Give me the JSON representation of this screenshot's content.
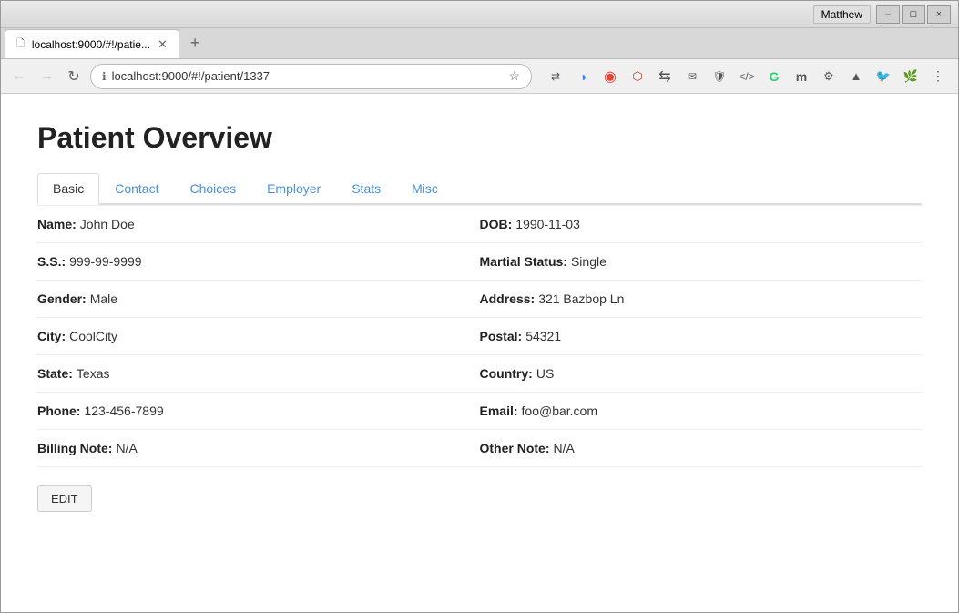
{
  "browser": {
    "tab_label": "localhost:9000/#!/patie...",
    "url": "localhost:9000/#!/patient/1337",
    "user": "Matthew"
  },
  "page": {
    "title": "Patient Overview"
  },
  "tabs": [
    {
      "id": "basic",
      "label": "Basic",
      "active": true
    },
    {
      "id": "contact",
      "label": "Contact",
      "active": false
    },
    {
      "id": "choices",
      "label": "Choices",
      "active": false
    },
    {
      "id": "employer",
      "label": "Employer",
      "active": false
    },
    {
      "id": "stats",
      "label": "Stats",
      "active": false
    },
    {
      "id": "misc",
      "label": "Misc",
      "active": false
    }
  ],
  "fields": {
    "left": [
      {
        "label": "Name:",
        "value": "John Doe"
      },
      {
        "label": "S.S.:",
        "value": "999-99-9999"
      },
      {
        "label": "Gender:",
        "value": "Male"
      },
      {
        "label": "City:",
        "value": "CoolCity"
      },
      {
        "label": "State:",
        "value": "Texas"
      },
      {
        "label": "Phone:",
        "value": "123-456-7899"
      },
      {
        "label": "Billing Note:",
        "value": "N/A"
      }
    ],
    "right": [
      {
        "label": "DOB:",
        "value": "1990-11-03"
      },
      {
        "label": "Martial Status:",
        "value": "Single"
      },
      {
        "label": "Address:",
        "value": "321 Bazbop Ln"
      },
      {
        "label": "Postal:",
        "value": "54321"
      },
      {
        "label": "Country:",
        "value": "US"
      },
      {
        "label": "Email:",
        "value": "foo@bar.com"
      },
      {
        "label": "Other Note:",
        "value": "N/A"
      }
    ]
  },
  "edit_button_label": "EDIT",
  "window_controls": {
    "minimize": "–",
    "maximize": "□",
    "close": "×"
  }
}
